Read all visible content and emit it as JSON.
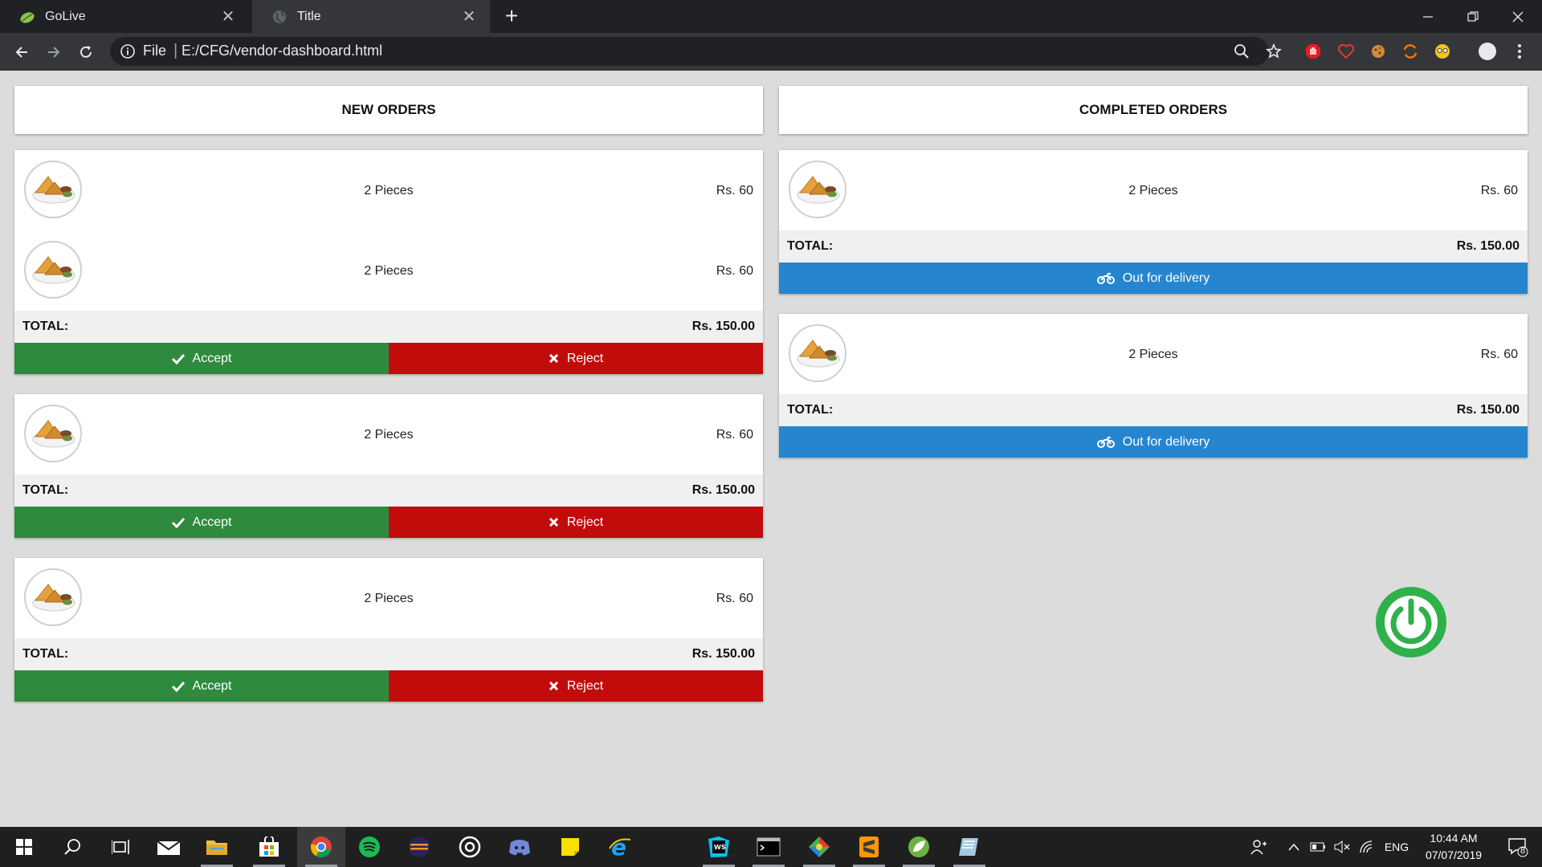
{
  "browser": {
    "tabs": [
      {
        "title": "GoLive",
        "active": false
      },
      {
        "title": "Title",
        "active": true
      }
    ],
    "address": {
      "scheme": "File",
      "url": "E:/CFG/vendor-dashboard.html"
    }
  },
  "colors": {
    "accept": "#2e8b3e",
    "reject": "#c20c0c",
    "delivery": "#2586cf",
    "power": "#2fb14a"
  },
  "new_orders": {
    "header": "NEW ORDERS",
    "orders": [
      {
        "items": [
          {
            "qty": "2 Pieces",
            "price": "Rs. 60"
          },
          {
            "qty": "2 Pieces",
            "price": "Rs. 60"
          }
        ],
        "total_label": "TOTAL:",
        "total": "Rs. 150.00",
        "accept_label": "Accept",
        "reject_label": "Reject"
      },
      {
        "items": [
          {
            "qty": "2 Pieces",
            "price": "Rs. 60"
          }
        ],
        "total_label": "TOTAL:",
        "total": "Rs. 150.00",
        "accept_label": "Accept",
        "reject_label": "Reject"
      },
      {
        "items": [
          {
            "qty": "2 Pieces",
            "price": "Rs. 60"
          }
        ],
        "total_label": "TOTAL:",
        "total": "Rs. 150.00",
        "accept_label": "Accept",
        "reject_label": "Reject"
      }
    ]
  },
  "completed_orders": {
    "header": "COMPLETED ORDERS",
    "orders": [
      {
        "items": [
          {
            "qty": "2 Pieces",
            "price": "Rs. 60"
          }
        ],
        "total_label": "TOTAL:",
        "total": "Rs. 150.00",
        "status_label": "Out for delivery"
      },
      {
        "items": [
          {
            "qty": "2 Pieces",
            "price": "Rs. 60"
          }
        ],
        "total_label": "TOTAL:",
        "total": "Rs. 150.00",
        "status_label": "Out for delivery"
      }
    ]
  },
  "taskbar": {
    "language": "ENG",
    "time": "10:44 AM",
    "date": "07/07/2019",
    "notifications": "8"
  }
}
